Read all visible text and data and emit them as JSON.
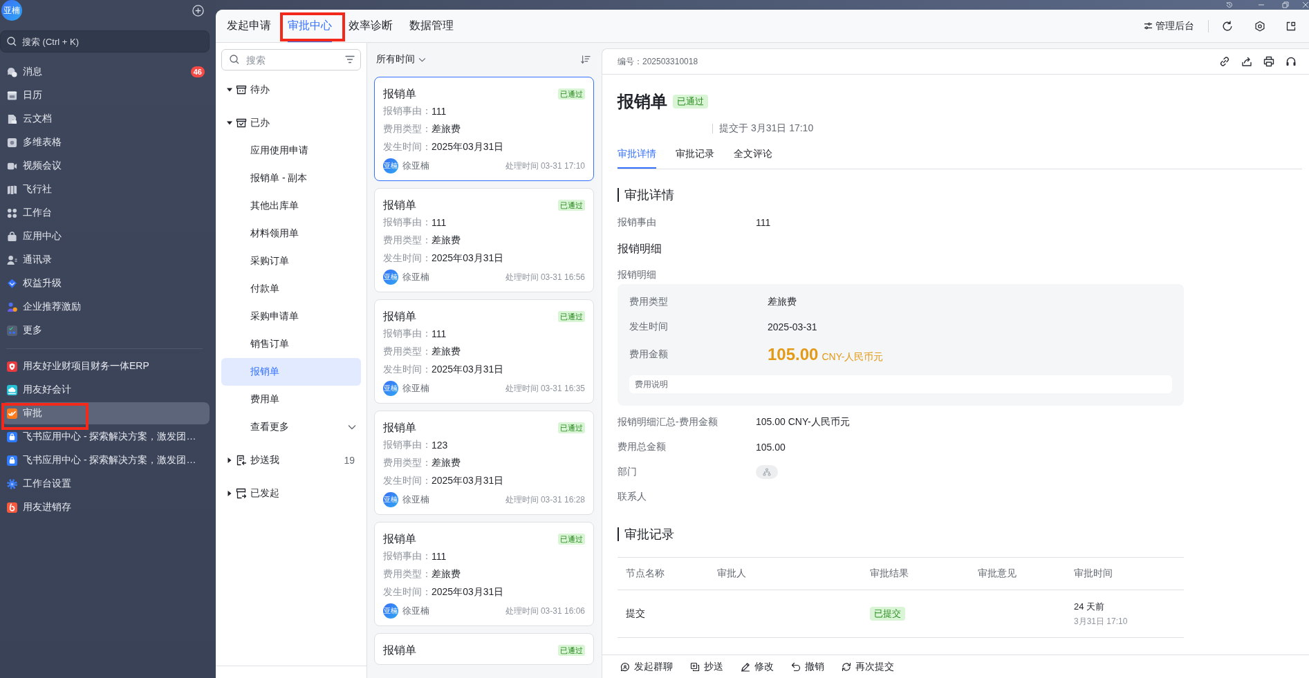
{
  "sidebar": {
    "avatar": "亚楠",
    "search_placeholder": "搜索 (Ctrl + K)",
    "nav_items": [
      {
        "label": "消息",
        "badge": "46",
        "selected": false
      },
      {
        "label": "日历",
        "selected": false
      },
      {
        "label": "云文档",
        "selected": false
      },
      {
        "label": "多维表格",
        "selected": false
      },
      {
        "label": "视频会议",
        "selected": false
      },
      {
        "label": "飞行社",
        "selected": false
      },
      {
        "label": "工作台",
        "selected": false
      },
      {
        "label": "应用中心",
        "selected": false
      },
      {
        "label": "通讯录",
        "selected": false
      },
      {
        "label": "权益升级",
        "selected": false
      },
      {
        "label": "企业推荐激励",
        "selected": false
      },
      {
        "label": "更多",
        "selected": false
      }
    ],
    "apps": [
      {
        "label": "用友好业财项目财务一体ERP",
        "selected": false,
        "annotated": false
      },
      {
        "label": "用友好会计",
        "selected": false,
        "annotated": false
      },
      {
        "label": "审批",
        "selected": true,
        "annotated": true
      },
      {
        "label": "飞书应用中心 - 探索解决方案，激发团…",
        "selected": false,
        "annotated": false
      },
      {
        "label": "飞书应用中心 - 探索解决方案，激发团…",
        "selected": false,
        "annotated": false
      },
      {
        "label": "工作台设置",
        "selected": false,
        "annotated": false
      },
      {
        "label": "用友进销存",
        "selected": false,
        "annotated": false
      }
    ]
  },
  "top_tabs": [
    {
      "label": "发起申请",
      "selected": false,
      "annotated": false
    },
    {
      "label": "审批中心",
      "selected": true,
      "annotated": true
    },
    {
      "label": "效率诊断",
      "selected": false,
      "annotated": false
    },
    {
      "label": "数据管理",
      "selected": false,
      "annotated": false
    }
  ],
  "toolbar": {
    "admin_button": "管理后台"
  },
  "tree": {
    "search_placeholder": "搜索",
    "groups": [
      {
        "label": "待办",
        "expanded": true
      },
      {
        "label": "已办",
        "expanded": true,
        "children": [
          {
            "label": "应用使用申请",
            "selected": false
          },
          {
            "label": "报销单 - 副本",
            "selected": false
          },
          {
            "label": "其他出库单",
            "selected": false
          },
          {
            "label": "材料领用单",
            "selected": false
          },
          {
            "label": "采购订单",
            "selected": false
          },
          {
            "label": "付款单",
            "selected": false
          },
          {
            "label": "采购申请单",
            "selected": false
          },
          {
            "label": "销售订单",
            "selected": false
          },
          {
            "label": "报销单",
            "selected": true
          },
          {
            "label": "费用单",
            "selected": false
          }
        ],
        "more": "查看更多"
      },
      {
        "label": "抄送我",
        "expanded": false,
        "count": "19"
      },
      {
        "label": "已发起",
        "expanded": false
      }
    ]
  },
  "list": {
    "time_filter": "所有时间",
    "cards": [
      {
        "title": "报销单",
        "status": "已通过",
        "selected": true,
        "fields": [
          {
            "label": "报销事由：",
            "value": "111"
          },
          {
            "label": "费用类型：",
            "value": "差旅费"
          },
          {
            "label": "发生时间：",
            "value": "2025年03月31日"
          }
        ],
        "avatar": "亚楠",
        "person": "徐亚楠",
        "time": "处理时间 03-31 17:10"
      },
      {
        "title": "报销单",
        "status": "已通过",
        "selected": false,
        "fields": [
          {
            "label": "报销事由：",
            "value": "111"
          },
          {
            "label": "费用类型：",
            "value": "差旅费"
          },
          {
            "label": "发生时间：",
            "value": "2025年03月31日"
          }
        ],
        "avatar": "亚楠",
        "person": "徐亚楠",
        "time": "处理时间 03-31 16:56"
      },
      {
        "title": "报销单",
        "status": "已通过",
        "selected": false,
        "fields": [
          {
            "label": "报销事由：",
            "value": "111"
          },
          {
            "label": "费用类型：",
            "value": "差旅费"
          },
          {
            "label": "发生时间：",
            "value": "2025年03月31日"
          }
        ],
        "avatar": "亚楠",
        "person": "徐亚楠",
        "time": "处理时间 03-31 16:35"
      },
      {
        "title": "报销单",
        "status": "已通过",
        "selected": false,
        "fields": [
          {
            "label": "报销事由：",
            "value": "123"
          },
          {
            "label": "费用类型：",
            "value": "差旅费"
          },
          {
            "label": "发生时间：",
            "value": "2025年03月31日"
          }
        ],
        "avatar": "亚楠",
        "person": "徐亚楠",
        "time": "处理时间 03-31 16:28"
      },
      {
        "title": "报销单",
        "status": "已通过",
        "selected": false,
        "fields": [
          {
            "label": "报销事由：",
            "value": "111"
          },
          {
            "label": "费用类型：",
            "value": "差旅费"
          },
          {
            "label": "发生时间：",
            "value": "2025年03月31日"
          }
        ],
        "avatar": "亚楠",
        "person": "徐亚楠",
        "time": "处理时间 03-31 16:06"
      },
      {
        "title": "报销单",
        "status": "已通过",
        "selected": false
      }
    ]
  },
  "detail": {
    "serial": "编号：202503310018",
    "title": "报销单",
    "status": "已通过",
    "submitted": "提交于 3月31日 17:10",
    "tabs": [
      {
        "label": "审批详情",
        "selected": true
      },
      {
        "label": "审批记录",
        "selected": false
      },
      {
        "label": "全文评论",
        "selected": false
      }
    ],
    "details_heading": "审批详情",
    "reason": {
      "label": "报销事由",
      "value": "111"
    },
    "breakdown_heading": "报销明细",
    "breakdown_label": "报销明细",
    "breakdown": {
      "rows": [
        {
          "label": "费用类型",
          "value": "差旅费"
        },
        {
          "label": "发生时间",
          "value": "2025-03-31"
        }
      ],
      "amount_label": "费用金额",
      "amount": "105.00",
      "currency": "CNY-人民币元",
      "note": "费用说明"
    },
    "fields": [
      {
        "kind": "text",
        "label": "报销明细汇总-费用金额",
        "value": "105.00 CNY-人民币元"
      },
      {
        "kind": "text",
        "label": "费用总金额",
        "value": "105.00"
      },
      {
        "kind": "department",
        "label": "部门"
      },
      {
        "kind": "text",
        "label": "联系人"
      }
    ],
    "records_heading": "审批记录",
    "records": {
      "columns": [
        "节点名称",
        "审批人",
        "审批结果",
        "审批意见",
        "审批时间"
      ],
      "rows": [
        {
          "node": "提交",
          "result": "已提交",
          "time_ago": "24 天前",
          "time": "3月31日 17:10"
        }
      ]
    },
    "actions": [
      "发起群聊",
      "抄送",
      "修改",
      "撤销",
      "再次提交"
    ]
  }
}
